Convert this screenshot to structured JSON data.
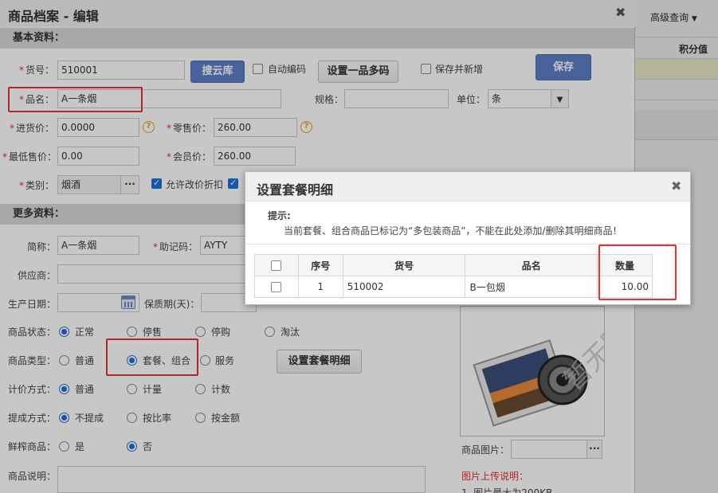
{
  "window": {
    "title": "商品档案 - 编辑",
    "close": "✖"
  },
  "bg": {
    "advanced_query": "高级查询",
    "column_points": "积分值"
  },
  "sections": {
    "basic": "基本资料：",
    "more": "更多资料："
  },
  "basic": {
    "sku_label": "货号：",
    "sku_value": "510001",
    "search_cloud_btn": "搜云库",
    "auto_code_label": "自动编码",
    "multi_code_btn": "设置一品多码",
    "save_new_label": "保存并新增",
    "save_btn": "保存",
    "name_label": "品名：",
    "name_value": "A一条烟",
    "spec_label": "规格：",
    "spec_value": "",
    "unit_label": "单位：",
    "unit_value": "条",
    "cost_label": "进货价：",
    "cost_value": "0.0000",
    "retail_label": "零售价：",
    "retail_value": "260.00",
    "min_price_label": "最低售价：",
    "min_price_value": "0.00",
    "member_label": "会员价：",
    "member_value": "260.00",
    "category_label": "类别：",
    "category_value": "烟酒",
    "allow_discount_label": "允许改价折扣",
    "help": "?"
  },
  "more": {
    "short_label": "简称：",
    "short_value": "A一条烟",
    "mnemonic_label": "助记码：",
    "mnemonic_value": "AYTY",
    "supplier_label": "供应商：",
    "prod_date_label": "生产日期：",
    "shelf_label": "保质期(天)：",
    "status_label": "商品状态：",
    "status_options": [
      "正常",
      "停售",
      "停购",
      "淘汰"
    ],
    "type_label": "商品类型：",
    "type_options": [
      "普通",
      "套餐、组合",
      "服务"
    ],
    "set_combo_btn": "设置套餐明细",
    "pricing_label": "计价方式：",
    "pricing_options": [
      "普通",
      "计量",
      "计数"
    ],
    "commission_label": "提成方式：",
    "commission_options": [
      "不提成",
      "按比率",
      "按金额"
    ],
    "fresh_label": "鲜榨商品：",
    "fresh_options": [
      "是",
      "否"
    ],
    "desc_label": "商品说明：",
    "image_label": "商品图片：",
    "no_image": "暂无图片",
    "upload_title": "图片上传说明：",
    "upload_note": "1. 图片最大为200KB"
  },
  "dialog": {
    "title": "设置套餐明细",
    "tip_label": "提示:",
    "tip_text": "当前套餐、组合商品已标记为“多包装商品”，不能在此处添加/删除其明细商品！",
    "headers": [
      "序号",
      "货号",
      "品名",
      "数量"
    ],
    "rows": [
      {
        "index": "1",
        "sku": "510002",
        "name": "B一包烟",
        "qty": "10.00"
      }
    ]
  },
  "colors": {
    "required": "#e0302b",
    "accent": "#1e6fd9",
    "save_blue": "#5c7fc6",
    "highlight": "#e03434"
  }
}
